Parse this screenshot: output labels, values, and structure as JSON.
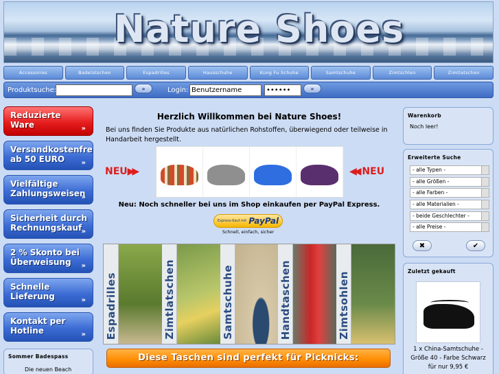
{
  "banner": {
    "title": "Nature Shoes"
  },
  "nav": [
    "Accessoires",
    "Badelatschen",
    "Espadrilles",
    "Hausschuhe",
    "Kung Fu Schuhe",
    "Samtschuhe",
    "Zimtschlen",
    "Zimtlatschen"
  ],
  "search": {
    "label": "Produktsuche:",
    "value": "",
    "go": "»"
  },
  "login": {
    "label": "Login:",
    "username": "Benutzername",
    "password": "••••••",
    "go": "»"
  },
  "left_buttons": [
    {
      "text": "Reduzierte Ware",
      "arrow": "»",
      "color": "red"
    },
    {
      "text": "Versandkostenfrei ab 50 EURO",
      "arrow": "»",
      "color": "blue"
    },
    {
      "text": "Vielfältige Zahlungsweisen",
      "arrow": "»",
      "color": "blue"
    },
    {
      "text": "Sicherheit durch Rechnungskauf",
      "arrow": "»",
      "color": "blue"
    },
    {
      "text": "2 % Skonto bei Überweisung",
      "arrow": "»",
      "color": "blue"
    },
    {
      "text": "Schnelle Lieferung",
      "arrow": "»",
      "color": "blue"
    },
    {
      "text": "Kontakt per Hotline",
      "arrow": "»",
      "color": "blue"
    }
  ],
  "sommer": {
    "header": "Sommer Badespass",
    "text": "Die neuen Beach"
  },
  "main": {
    "title": "Herzlich Willkommen bei Nature Shoes!",
    "intro": "Bei uns finden Sie Produkte aus natürlichen Rohstoffen, überwiegend oder teilweise in Handarbeit hergestellt.",
    "neu_left": "NEU",
    "neu_right": "NEU",
    "express": "Neu: Noch schneller bei uns im Shop einkaufen per PayPal Express.",
    "paypal_small": "Express-Kauf mit",
    "paypal_logo": "PayPal",
    "paypal_sub": "Schnell, einfach, sicher",
    "categories": [
      "Espadrilles",
      "Zimtlatschen",
      "Samtschuhe",
      "Handtaschen",
      "Zimtsohlen"
    ],
    "orange_banner": "Diese Taschen sind perfekt für Picknicks:"
  },
  "cart": {
    "header": "Warenkorb",
    "text": "Noch leer!"
  },
  "advanced_search": {
    "header": "Erweiterte Suche",
    "selects": [
      "- alle Typen -",
      "- alle Größen -",
      "- alle Farben -",
      "- alle Materialien -",
      "- beide Geschlechter -",
      "- alle Preise -"
    ],
    "clear": "✖",
    "apply": "✔"
  },
  "last_bought": {
    "header": "Zuletzt gekauft",
    "line1": "1 x China-Samtschuhe -",
    "line2": "Größe 40 - Farbe Schwarz",
    "line3": "für nur 9,95 €"
  },
  "colors": {
    "nav": "#5c8ad8",
    "accent_red": "#e61e1e",
    "orange": "#ff8c00",
    "neu": "#dc1e1e"
  }
}
